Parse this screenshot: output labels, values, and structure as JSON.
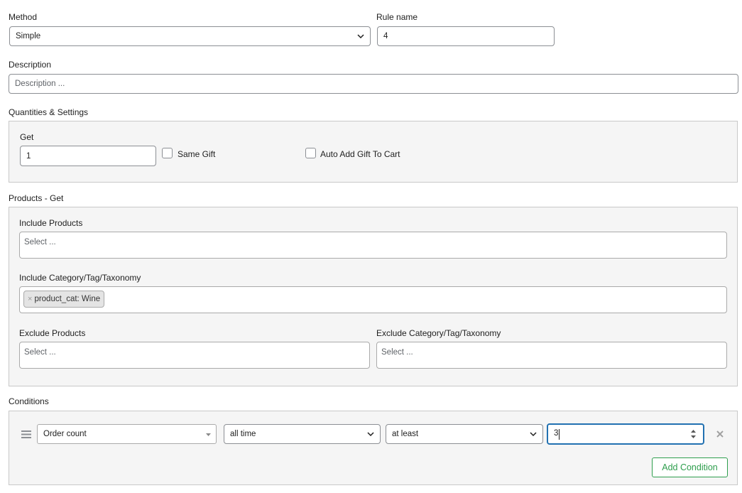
{
  "method": {
    "label": "Method",
    "value": "Simple"
  },
  "rule_name": {
    "label": "Rule name",
    "value": "4"
  },
  "description": {
    "label": "Description",
    "placeholder": "Description ..."
  },
  "quantities": {
    "title": "Quantities & Settings",
    "get_label": "Get",
    "get_value": "1",
    "same_gift_label": "Same Gift",
    "auto_add_label": "Auto Add Gift To Cart"
  },
  "products_get": {
    "title": "Products - Get",
    "include_products_label": "Include Products",
    "include_products_placeholder": "Select ...",
    "include_category_label": "Include Category/Tag/Taxonomy",
    "include_category_tags": [
      {
        "text": "product_cat: Wine",
        "remove": "×"
      }
    ],
    "exclude_products_label": "Exclude Products",
    "exclude_products_placeholder": "Select ...",
    "exclude_category_label": "Exclude Category/Tag/Taxonomy",
    "exclude_category_placeholder": "Select ..."
  },
  "conditions": {
    "title": "Conditions",
    "rows": [
      {
        "type": "Order count",
        "period": "all time",
        "comparison": "at least",
        "value": "3"
      }
    ],
    "add_button": "Add Condition"
  },
  "icons": {
    "drag": "drag-handle-icon",
    "chevron": "chevron-down-icon",
    "remove": "close-icon",
    "spinner": "number-spinner-icon"
  },
  "colors": {
    "accent": "#2271b1",
    "add_button": "#2e9e4d",
    "panel_bg": "#f5f5f5"
  }
}
